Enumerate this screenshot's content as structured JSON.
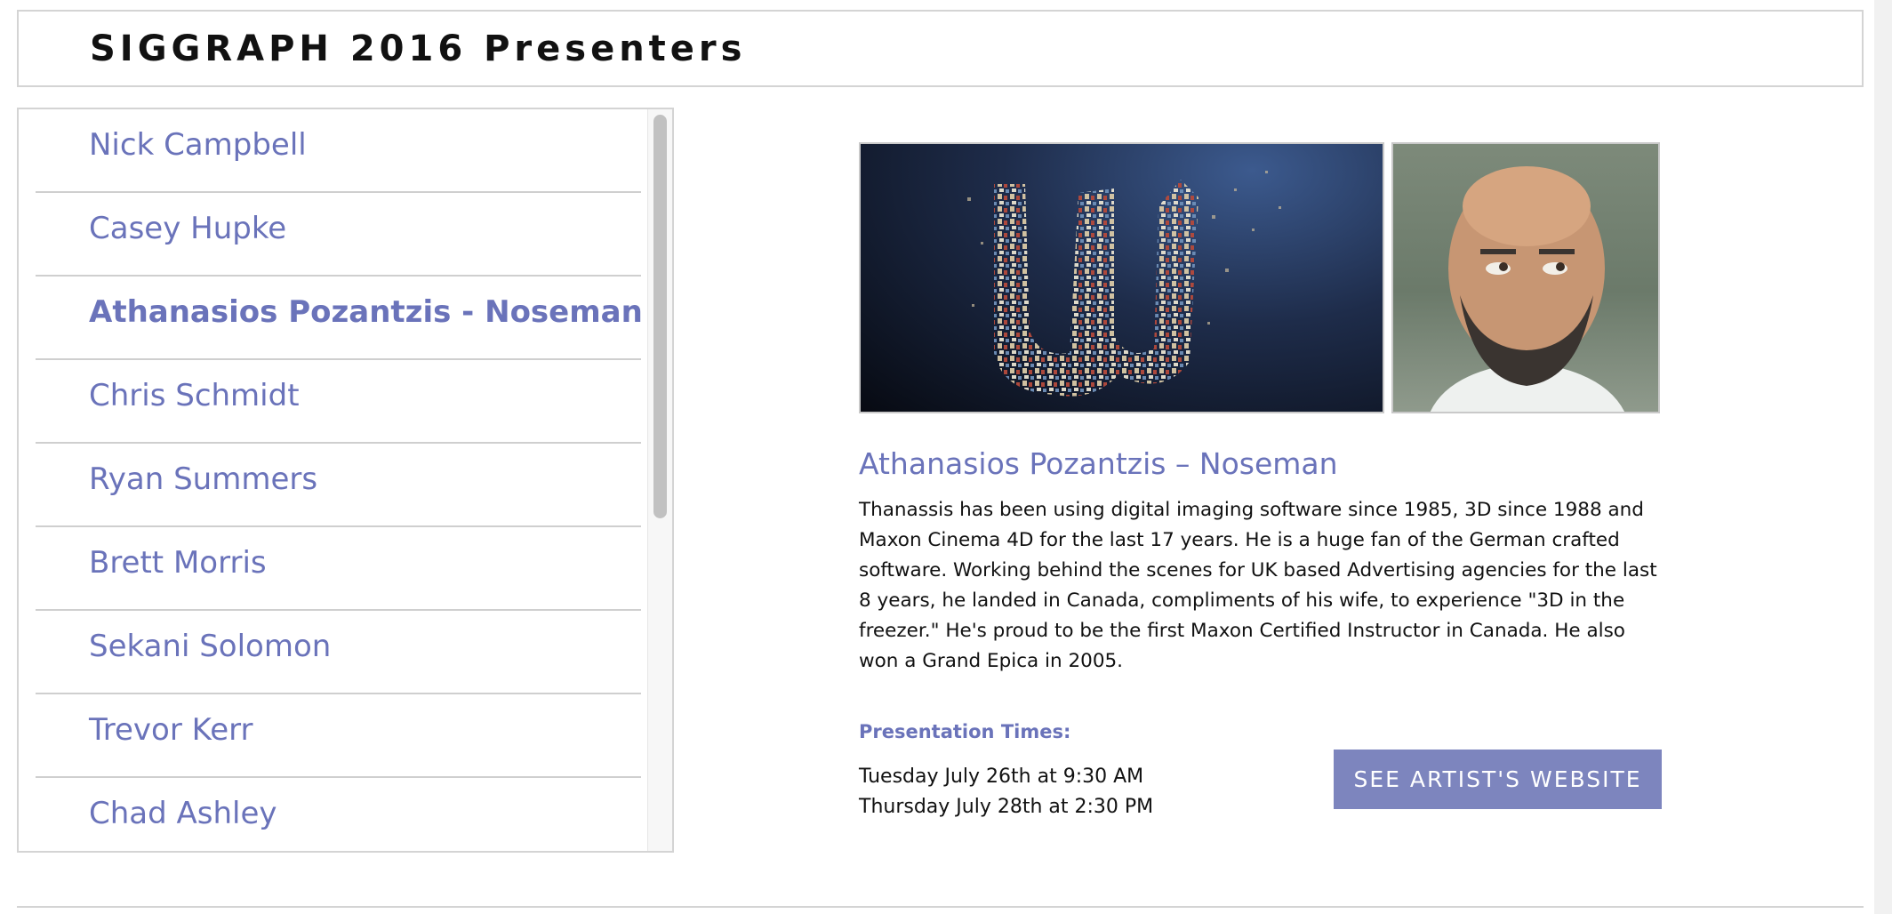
{
  "header": {
    "title": "SIGGRAPH 2016 Presenters"
  },
  "sidebar": {
    "items": [
      {
        "label": "Nick Campbell",
        "active": false
      },
      {
        "label": "Casey Hupke",
        "active": false
      },
      {
        "label": "Athanasios Pozantzis - Noseman",
        "active": true
      },
      {
        "label": "Chris Schmidt",
        "active": false
      },
      {
        "label": "Ryan Summers",
        "active": false
      },
      {
        "label": "Brett Morris",
        "active": false
      },
      {
        "label": "Sekani Solomon",
        "active": false
      },
      {
        "label": "Trevor Kerr",
        "active": false
      },
      {
        "label": "Chad Ashley",
        "active": false
      }
    ]
  },
  "detail": {
    "name": "Athanasios Pozantzis – Noseman",
    "bio": "Thanassis has been using digital imaging software since 1985, 3D since 1988 and Maxon Cinema 4D for the last 17 years. He is a huge fan of the German crafted software. Working behind the scenes for UK based Advertising agencies for the last 8 years, he landed in Canada, compliments of his wife, to experience \"3D in the freezer.\" He's proud to be the first Maxon Certified Instructor in Canada. He also won a Grand Epica in 2005.",
    "times_heading": "Presentation Times:",
    "times": [
      "Tuesday July 26th at 9:30 AM",
      "Thursday July 28th at 2:30 PM"
    ],
    "website_button": "SEE ARTIST'S WEBSITE"
  },
  "colors": {
    "accent": "#6a73ba",
    "button": "#7d85be",
    "border": "#d4d4d4"
  }
}
